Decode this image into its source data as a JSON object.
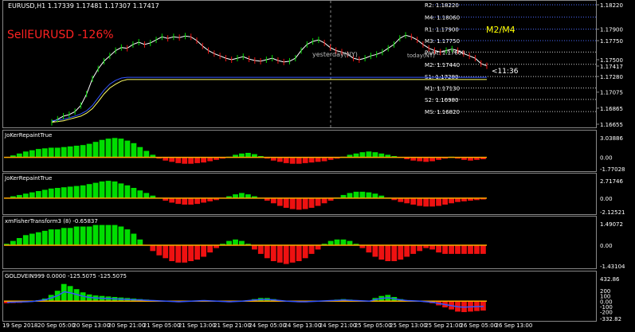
{
  "colors": {
    "bg": "#000000",
    "grid": "#4a4a4a",
    "price_line": "#ffffff",
    "ma_line": "#00ff00",
    "band_low": "#ffff66",
    "band_high": "#3355ff",
    "bull": "#00dd00",
    "bear": "#ee1111",
    "zero_line": "#ffaa00",
    "sell_label": "#ff2222",
    "m2m4": "#ffff00",
    "pivot_r": "#4d6bff",
    "pivot_s": "#cccccc"
  },
  "header": {
    "title": "EURUSD,H1  1.17339 1.17481 1.17307 1.17417",
    "sell_label": "SellEURUSD -126%",
    "m2m4_label": "M2/M4",
    "timer": "<11:36",
    "yesterday_label": "yesterday(NY)",
    "today_label": "today(NY)"
  },
  "chart_data": [
    {
      "type": "line",
      "title": "EURUSD,H1  1.17339 1.17481 1.17307 1.17417",
      "ylim": [
        1.16655,
        1.1822
      ],
      "y_ticks": [
        "1.18220",
        "1.18060",
        "1.17900",
        "1.17750",
        "1.17600",
        "1.17500",
        "1.17417",
        "1.17280",
        "1.17130",
        "1.17075",
        "1.16980",
        "1.16865",
        "1.16820",
        "1.16655"
      ],
      "axis_labels": [
        "1.18220",
        "1.17900",
        "1.17750",
        "1.17500",
        "1.17417",
        "1.17280",
        "1.17075",
        "1.16865",
        "1.16655"
      ],
      "x_ticks": [
        "19 Sep 2018",
        "20 Sep 05:00",
        "20 Sep 13:00",
        "20 Sep 21:00",
        "21 Sep 05:00",
        "21 Sep 13:00",
        "21 Sep 21:00",
        "24 Sep 05:00",
        "24 Sep 13:00",
        "24 Sep 21:00",
        "25 Sep 05:00",
        "25 Sep 13:00",
        "25 Sep 21:00",
        "26 Sep 05:00",
        "26 Sep 13:00"
      ],
      "pivot_levels": [
        {
          "name": "R2",
          "value": 1.1822,
          "label": "R2: 1.18220"
        },
        {
          "name": "M4",
          "value": 1.1806,
          "label": "M4: 1.18060"
        },
        {
          "name": "R1",
          "value": 1.179,
          "label": "R1: 1.17900"
        },
        {
          "name": "M3",
          "value": 1.1775,
          "label": "M3: 1.17750"
        },
        {
          "name": "Pivot",
          "value": 1.176,
          "label": "Pivot: 1.17600"
        },
        {
          "name": "M2",
          "value": 1.1744,
          "label": "M2: 1.17440"
        },
        {
          "name": "S1",
          "value": 1.1728,
          "label": "S1: 1.17280"
        },
        {
          "name": "M1",
          "value": 1.1713,
          "label": "M1: 1.17130"
        },
        {
          "name": "S2",
          "value": 1.1698,
          "label": "S2: 1.16980"
        },
        {
          "name": "MS",
          "value": 1.1682,
          "label": "MS: 1.16820"
        }
      ],
      "series": [
        {
          "values": [
            1.1668,
            1.1672,
            1.1676,
            1.1678,
            1.1682,
            1.169,
            1.1705,
            1.1725,
            1.1738,
            1.1748,
            1.1755,
            1.1762,
            1.1766,
            1.1765,
            1.177,
            1.1773,
            1.177,
            1.1772,
            1.1776,
            1.178,
            1.1778,
            1.178,
            1.1779,
            1.1781,
            1.178,
            1.1775,
            1.1768,
            1.1762,
            1.1758,
            1.1755,
            1.1752,
            1.175,
            1.1752,
            1.1754,
            1.1751,
            1.1749,
            1.1748,
            1.175,
            1.1752,
            1.1749,
            1.1747,
            1.1748,
            1.1752,
            1.1762,
            1.177,
            1.1774,
            1.1776,
            1.1772,
            1.1766,
            1.1762,
            1.176,
            1.1757,
            1.1752,
            1.175,
            1.1752,
            1.1755,
            1.1757,
            1.176,
            1.1765,
            1.177,
            1.1778,
            1.1782,
            1.178,
            1.1776,
            1.177,
            1.1765,
            1.1762,
            1.176,
            1.1762,
            1.1764,
            1.1762,
            1.1758,
            1.1755,
            1.1752,
            1.1745,
            1.1742
          ]
        },
        {
          "values": [
            1.1668,
            1.1669,
            1.167,
            1.1672,
            1.1674,
            1.1676,
            1.168,
            1.1686,
            1.1695,
            1.1705,
            1.1713,
            1.1718,
            1.1722,
            1.1724,
            1.1724,
            1.1724,
            1.1724,
            1.1724,
            1.1724,
            1.1724,
            1.1724,
            1.1724,
            1.1724,
            1.1724,
            1.1724,
            1.1724,
            1.1724,
            1.1724,
            1.1724,
            1.1724,
            1.1724,
            1.1724,
            1.1724,
            1.1724,
            1.1724,
            1.1724,
            1.1724,
            1.1724,
            1.1724,
            1.1724,
            1.1724,
            1.1724,
            1.1724,
            1.1724,
            1.1724,
            1.1724,
            1.1724,
            1.1724,
            1.1724,
            1.1724,
            1.1724,
            1.1724,
            1.1724,
            1.1724,
            1.1724,
            1.1724,
            1.1724,
            1.1724,
            1.1724,
            1.1724,
            1.1724,
            1.1724,
            1.1724,
            1.1724,
            1.1724,
            1.1724,
            1.1724,
            1.1724,
            1.1724,
            1.1724,
            1.1724,
            1.1724,
            1.1724,
            1.1724,
            1.1724,
            1.1724
          ]
        },
        {
          "values": [
            1.167,
            1.1671,
            1.1672,
            1.1674,
            1.1676,
            1.1679,
            1.1683,
            1.169,
            1.17,
            1.171,
            1.1718,
            1.1723,
            1.1726,
            1.1727,
            1.1727,
            1.1727,
            1.1727,
            1.1727,
            1.1727,
            1.1727,
            1.1727,
            1.1727,
            1.1727,
            1.1727,
            1.1727,
            1.1727,
            1.1727,
            1.1727,
            1.1727,
            1.1727,
            1.1727,
            1.1727,
            1.1727,
            1.1727,
            1.1727,
            1.1727,
            1.1727,
            1.1727,
            1.1727,
            1.1727,
            1.1727,
            1.1727,
            1.1727,
            1.1727,
            1.1727,
            1.1727,
            1.1727,
            1.1727,
            1.1727,
            1.1727,
            1.1727,
            1.1727,
            1.1727,
            1.1727,
            1.1727,
            1.1727,
            1.1727,
            1.1727,
            1.1727,
            1.1727,
            1.1727,
            1.1727,
            1.1727,
            1.1727,
            1.1727,
            1.1727,
            1.1727,
            1.1727,
            1.1727,
            1.1727,
            1.1727,
            1.1727,
            1.1727,
            1.1727,
            1.1727,
            1.1727
          ]
        }
      ]
    },
    {
      "type": "bar",
      "title": "JoKerRepaintTrue",
      "ylim": [
        -1.77028,
        3.03886
      ],
      "y_ticks": [
        "3.03886",
        "0.00",
        "-1.77028"
      ],
      "values": [
        0.0,
        0.3,
        0.6,
        0.9,
        1.1,
        1.3,
        1.4,
        1.5,
        1.5,
        1.6,
        1.7,
        1.8,
        1.9,
        2.1,
        2.4,
        2.7,
        2.9,
        3.0,
        2.9,
        2.6,
        2.2,
        1.6,
        1.0,
        0.4,
        -0.2,
        -0.5,
        -0.7,
        -0.9,
        -1.0,
        -1.0,
        -0.9,
        -0.8,
        -0.6,
        -0.4,
        -0.2,
        0.1,
        0.4,
        0.6,
        0.7,
        0.5,
        0.2,
        -0.2,
        -0.5,
        -0.7,
        -0.9,
        -1.0,
        -1.0,
        -0.9,
        -0.8,
        -0.7,
        -0.6,
        -0.4,
        -0.2,
        0.1,
        0.4,
        0.6,
        0.8,
        0.9,
        0.8,
        0.6,
        0.4,
        0.2,
        -0.1,
        -0.3,
        -0.5,
        -0.6,
        -0.7,
        -0.6,
        -0.4,
        -0.2,
        0.1,
        -0.2,
        -0.4,
        -0.5,
        -0.4,
        -0.3
      ]
    },
    {
      "type": "bar",
      "title": "JoKerRepaintTrue",
      "ylim": [
        -2.12521,
        2.71746
      ],
      "y_ticks": [
        "2.71746",
        "0.00",
        "-2.12521"
      ],
      "values": [
        0.0,
        0.3,
        0.5,
        0.7,
        0.9,
        1.1,
        1.3,
        1.5,
        1.6,
        1.7,
        1.8,
        1.9,
        2.0,
        2.2,
        2.4,
        2.6,
        2.7,
        2.6,
        2.3,
        2.0,
        1.6,
        1.2,
        0.8,
        0.4,
        0.0,
        -0.4,
        -0.7,
        -0.9,
        -1.0,
        -1.0,
        -0.9,
        -0.7,
        -0.5,
        -0.3,
        0.0,
        0.3,
        0.6,
        0.8,
        0.6,
        0.3,
        0.0,
        -0.4,
        -0.8,
        -1.2,
        -1.5,
        -1.7,
        -1.8,
        -1.7,
        -1.5,
        -1.2,
        -0.8,
        -0.4,
        0.1,
        0.5,
        0.8,
        1.0,
        1.0,
        0.9,
        0.7,
        0.4,
        0.1,
        -0.3,
        -0.6,
        -0.8,
        -1.0,
        -1.2,
        -1.3,
        -1.3,
        -1.2,
        -1.0,
        -0.8,
        -0.6,
        -0.5,
        -0.4,
        -0.3,
        -0.2
      ]
    },
    {
      "type": "bar",
      "title": "xmFisherTransform3 (8) -0.65837",
      "ylim": [
        -1.43104,
        1.49072
      ],
      "y_ticks": [
        "1.49072",
        "0.00",
        "-1.43104"
      ],
      "values": [
        0.1,
        0.3,
        0.5,
        0.7,
        0.8,
        0.9,
        1.0,
        1.1,
        1.1,
        1.2,
        1.2,
        1.3,
        1.3,
        1.3,
        1.4,
        1.4,
        1.4,
        1.4,
        1.3,
        1.1,
        0.8,
        0.4,
        0.0,
        -0.4,
        -0.7,
        -0.9,
        -1.1,
        -1.2,
        -1.2,
        -1.1,
        -1.0,
        -0.8,
        -0.5,
        -0.2,
        0.1,
        0.3,
        0.4,
        0.3,
        0.1,
        -0.3,
        -0.6,
        -0.9,
        -1.1,
        -1.2,
        -1.3,
        -1.2,
        -1.1,
        -0.9,
        -0.6,
        -0.3,
        0.1,
        0.3,
        0.4,
        0.4,
        0.3,
        0.1,
        -0.2,
        -0.5,
        -0.8,
        -1.0,
        -1.1,
        -1.1,
        -1.0,
        -0.8,
        -0.6,
        -0.4,
        -0.2,
        -0.3,
        -0.5,
        -0.6,
        -0.6,
        -0.6,
        -0.6,
        -0.6,
        -0.6,
        -0.6
      ]
    },
    {
      "type": "bar",
      "title": "GOLDVEIN999 0.0000 -125.5075 -125.5075",
      "ylim": [
        -332.82,
        432.86
      ],
      "y_ticks": [
        "432.86",
        "200",
        "100",
        "0.00",
        "-100",
        "-200",
        "-332.82"
      ],
      "values": [
        -40,
        -35,
        -30,
        -20,
        -10,
        20,
        50,
        120,
        200,
        330,
        290,
        230,
        170,
        130,
        110,
        100,
        90,
        80,
        70,
        60,
        50,
        40,
        30,
        20,
        10,
        0,
        -10,
        -20,
        -10,
        0,
        10,
        20,
        10,
        0,
        -10,
        -20,
        -10,
        0,
        20,
        40,
        60,
        60,
        40,
        20,
        0,
        -10,
        -20,
        -20,
        -10,
        0,
        10,
        20,
        30,
        40,
        30,
        20,
        10,
        0,
        60,
        100,
        120,
        80,
        40,
        20,
        10,
        0,
        -20,
        -40,
        -80,
        -120,
        -160,
        -200,
        -210,
        -200,
        -190,
        -180
      ]
    }
  ]
}
